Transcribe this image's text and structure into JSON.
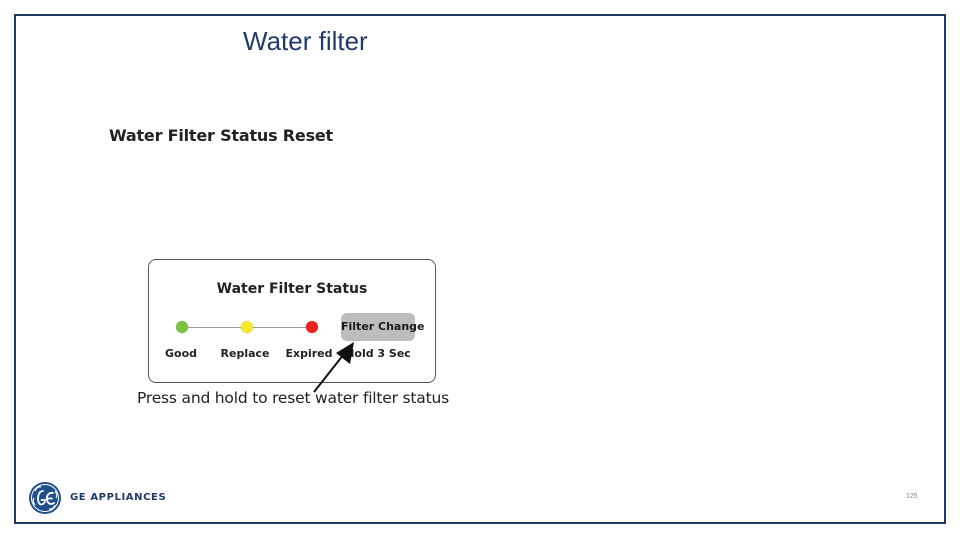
{
  "slide": {
    "title": "Water filter",
    "section_heading": "Water Filter Status Reset",
    "page_number": "125"
  },
  "status_panel": {
    "title": "Water Filter Status",
    "indicators": [
      {
        "label": "Good",
        "color": "#7cc242"
      },
      {
        "label": "Replace",
        "color": "#f5e92a"
      },
      {
        "label": "Expired",
        "color": "#e8231b"
      }
    ],
    "button": {
      "label": "Filter Change",
      "hint": "Hold 3 Sec"
    }
  },
  "caption": "Press and hold to reset water filter status",
  "footer": {
    "brand_name": "GE APPLIANCES",
    "logo_icon": "ge-monogram-icon"
  },
  "colors": {
    "frame_border": "#1f3864",
    "title": "#1f3a6b",
    "button_bg": "#bdbdbd",
    "brand": "#1f3a6b"
  }
}
